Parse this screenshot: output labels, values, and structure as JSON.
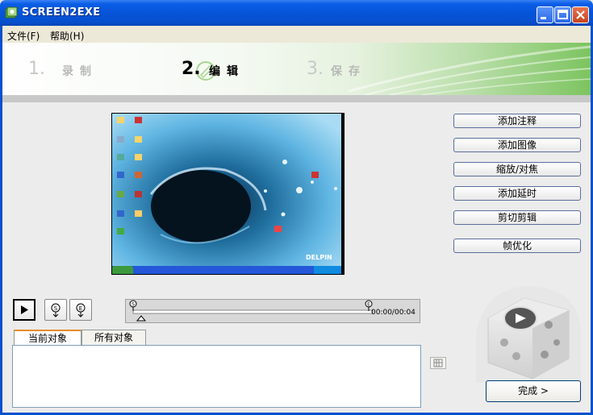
{
  "window": {
    "title": "SCREEN2EXE",
    "colors": {
      "titlebar": "#0654d8",
      "banner_accent": "#7cc45f",
      "tab_highlight": "#e68b2c"
    }
  },
  "menu": {
    "items": [
      "文件(F)",
      "帮助(H)"
    ]
  },
  "steps": [
    {
      "number": "1.",
      "label": "录制",
      "active": false
    },
    {
      "number": "2.",
      "label": "编辑",
      "active": true
    },
    {
      "number": "3.",
      "label": "保存",
      "active": false
    }
  ],
  "preview": {
    "watermark": "DELPIN"
  },
  "actions": {
    "add_note": "添加注释",
    "add_image": "添加图像",
    "zoom_focus": "缩放/对焦",
    "add_delay": "添加延时",
    "cut_edit": "剪切剪辑",
    "frame_optimize": "帧优化"
  },
  "playback": {
    "start_marker": "S",
    "end_marker": "E",
    "time": "00:00/00:04"
  },
  "tabs": {
    "current_objects": "当前对象",
    "all_objects": "所有对象"
  },
  "finish_button": "完成 >"
}
